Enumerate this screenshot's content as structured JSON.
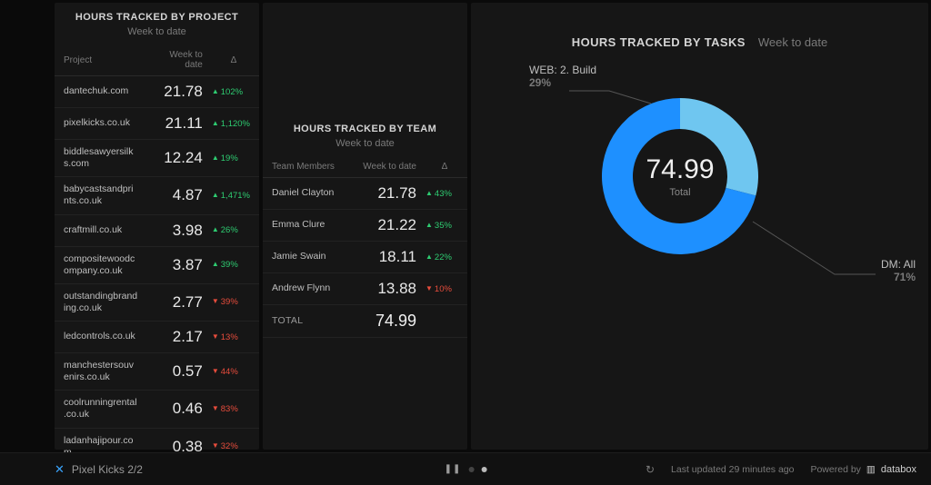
{
  "panel_project": {
    "title": "HOURS TRACKED BY PROJECT",
    "subtitle": "Week to date",
    "columns": {
      "c0": "Project",
      "c1": "Week to date",
      "c2": "Δ"
    },
    "rows": [
      {
        "name": "dantechuk.com",
        "value": "21.78",
        "delta": "102%",
        "dir": "up"
      },
      {
        "name": "pixelkicks.co.uk",
        "value": "21.11",
        "delta": "1,120%",
        "dir": "up"
      },
      {
        "name": "biddlesawyersilks.com",
        "value": "12.24",
        "delta": "19%",
        "dir": "up"
      },
      {
        "name": "babycastsandprints.co.uk",
        "value": "4.87",
        "delta": "1,471%",
        "dir": "up"
      },
      {
        "name": "craftmill.co.uk",
        "value": "3.98",
        "delta": "26%",
        "dir": "up"
      },
      {
        "name": "compositewoodcompany.co.uk",
        "value": "3.87",
        "delta": "39%",
        "dir": "up"
      },
      {
        "name": "outstandingbranding.co.uk",
        "value": "2.77",
        "delta": "39%",
        "dir": "down"
      },
      {
        "name": "ledcontrols.co.uk",
        "value": "2.17",
        "delta": "13%",
        "dir": "down"
      },
      {
        "name": "manchestersouvenirs.co.uk",
        "value": "0.57",
        "delta": "44%",
        "dir": "down"
      },
      {
        "name": "coolrunningrental.co.uk",
        "value": "0.46",
        "delta": "83%",
        "dir": "down"
      },
      {
        "name": "ladanhajipour.com",
        "value": "0.38",
        "delta": "32%",
        "dir": "down"
      }
    ]
  },
  "panel_team": {
    "title": "HOURS TRACKED BY TEAM",
    "subtitle": "Week to date",
    "columns": {
      "c0": "Team Members",
      "c1": "Week to date",
      "c2": "Δ"
    },
    "rows": [
      {
        "name": "Daniel Clayton",
        "value": "21.78",
        "delta": "43%",
        "dir": "up"
      },
      {
        "name": "Emma Clure",
        "value": "21.22",
        "delta": "35%",
        "dir": "up"
      },
      {
        "name": "Jamie Swain",
        "value": "18.11",
        "delta": "22%",
        "dir": "up"
      },
      {
        "name": "Andrew Flynn",
        "value": "13.88",
        "delta": "10%",
        "dir": "down"
      }
    ],
    "total_label": "TOTAL",
    "total_value": "74.99"
  },
  "panel_tasks": {
    "title": "HOURS TRACKED BY TASKS",
    "subtitle": "Week to date",
    "total_label": "Total",
    "total_value": "74.99",
    "slices": [
      {
        "label": "WEB: 2. Build",
        "pct_label": "29%",
        "pct": 29,
        "color": "#6fc6f0"
      },
      {
        "label": "DM: All",
        "pct_label": "71%",
        "pct": 71,
        "color": "#1e90ff"
      }
    ]
  },
  "footer": {
    "board_name": "Pixel Kicks 2/2",
    "updated": "Last updated 29 minutes ago",
    "powered": "Powered by",
    "brand": "databox"
  },
  "chart_data": {
    "type": "pie",
    "title": "HOURS TRACKED BY TASKS",
    "subtitle": "Week to date",
    "total": 74.99,
    "series": [
      {
        "name": "WEB: 2. Build",
        "value": 21.75,
        "percent": 29
      },
      {
        "name": "DM: All",
        "value": 53.24,
        "percent": 71
      }
    ]
  }
}
